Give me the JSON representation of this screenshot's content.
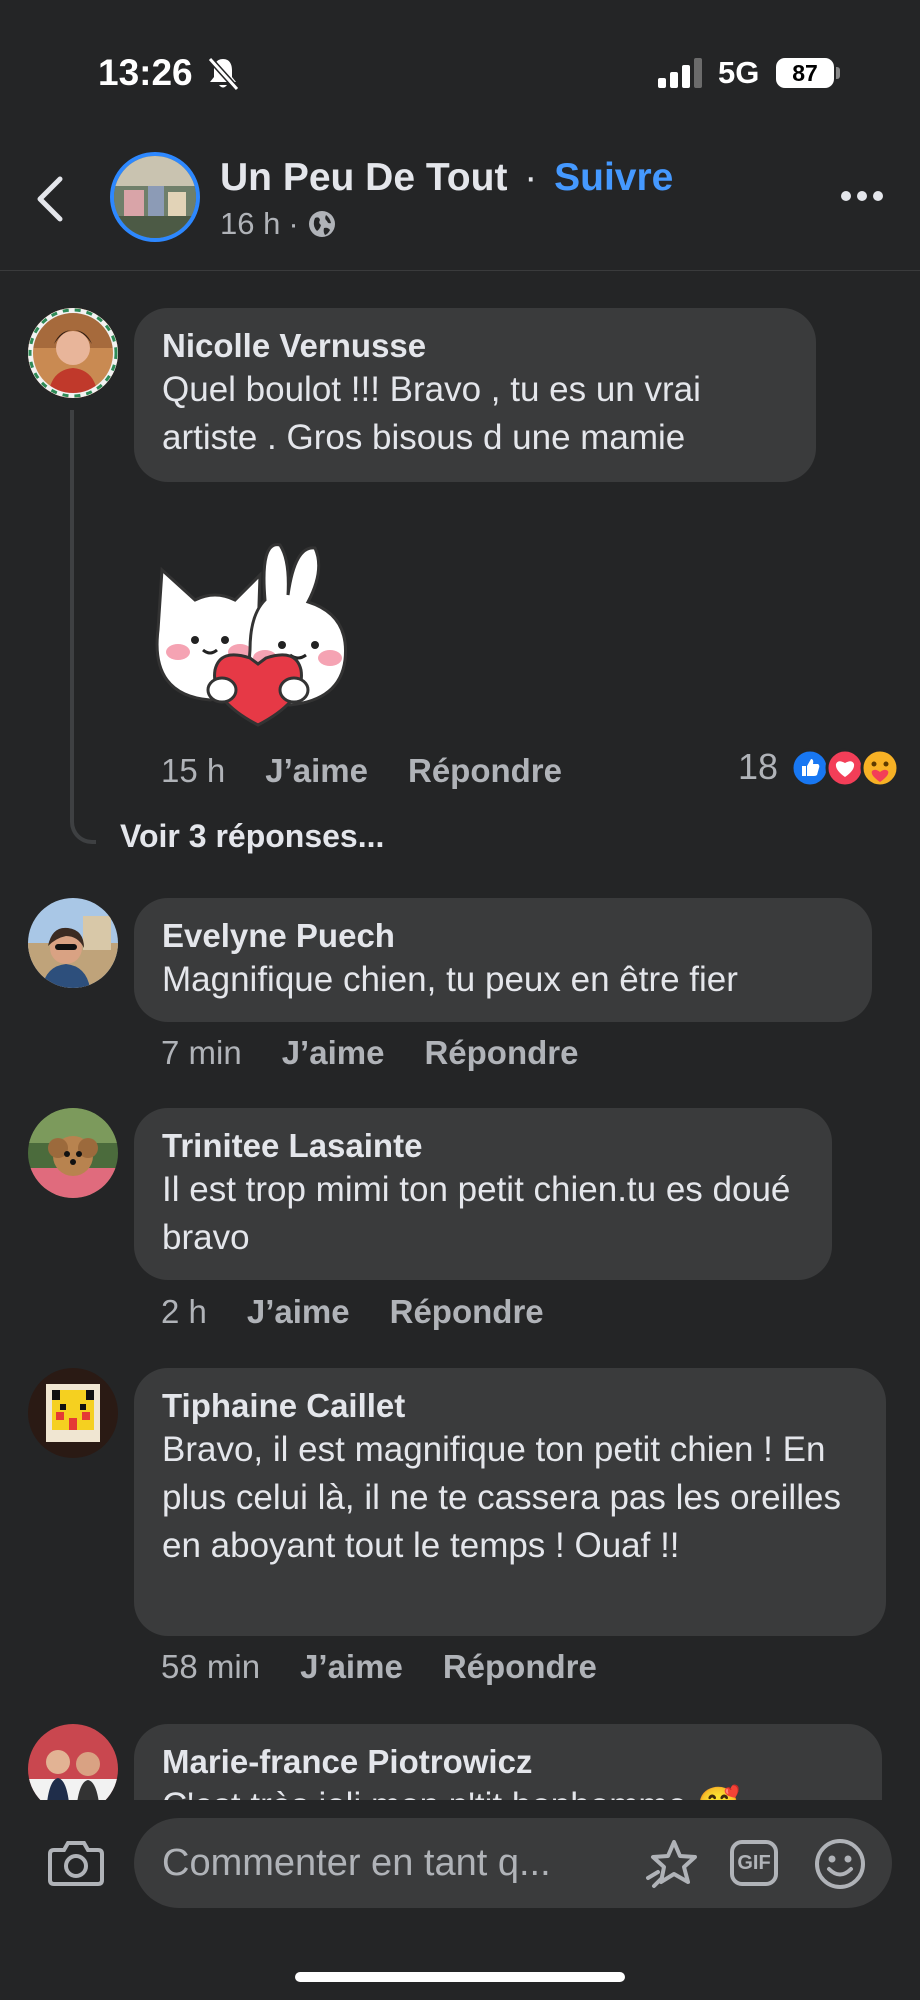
{
  "status_bar": {
    "time": "13:26",
    "network": "5G",
    "battery": "87"
  },
  "header": {
    "page_name": "Un Peu De Tout",
    "separator": "·",
    "follow_label": "Suivre",
    "time_ago": "16 h",
    "meta_separator": "·",
    "privacy_icon": "globe-icon",
    "back_icon": "chevron-left-icon",
    "more_icon": "more-dots-icon"
  },
  "comments": [
    {
      "author": "Nicolle Vernusse",
      "text": "Quel boulot !!! Bravo , tu es un vrai artiste . Gros bisous d une mamie",
      "time": "15 h",
      "like_label": "J’aime",
      "reply_label": "Répondre",
      "reactions_count": "18",
      "reaction_icons": [
        "like-icon",
        "love-icon",
        "care-icon"
      ],
      "sticker": "cat-and-bunny-heart-sticker",
      "view_replies": "Voir 3 réponses..."
    },
    {
      "author": "Evelyne Puech",
      "text": "Magnifique chien, tu peux en être fier",
      "time": "7 min",
      "like_label": "J’aime",
      "reply_label": "Répondre"
    },
    {
      "author": "Trinitee Lasainte",
      "text": "Il est trop mimi ton petit chien.tu es doué  bravo",
      "time": "2 h",
      "like_label": "J’aime",
      "reply_label": "Répondre"
    },
    {
      "author": "Tiphaine Caillet",
      "text": "Bravo, il est magnifique ton petit chien ! En plus celui là,  il ne te cassera pas les oreilles en aboyant tout le temps ! Ouaf !!",
      "time": "58 min",
      "like_label": "J’aime",
      "reply_label": "Répondre"
    },
    {
      "author": "Marie-france Piotrowicz",
      "text": "C'est très joli mon p'tit bonhomme 🥰"
    }
  ],
  "composer": {
    "placeholder": "Commenter en tant q...",
    "gif_label": "GIF",
    "camera_icon": "camera-icon",
    "sticker_icon": "sticker-icon",
    "emoji_icon": "emoji-icon"
  },
  "colors": {
    "background": "#242526",
    "bubble": "#3a3b3c",
    "accent": "#4599ff",
    "secondary_text": "#b0b3b8"
  }
}
